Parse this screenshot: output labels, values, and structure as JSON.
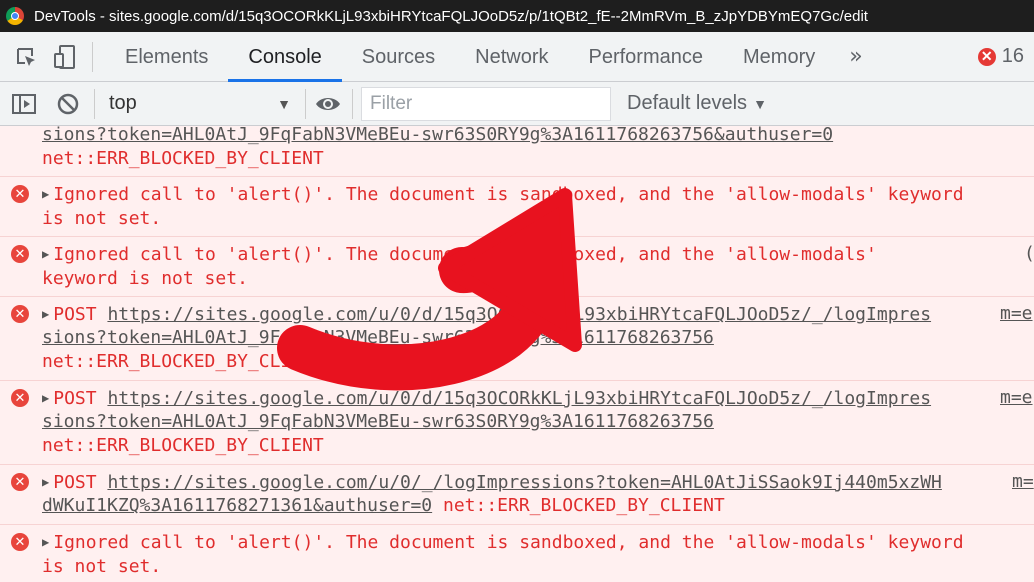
{
  "window": {
    "title": "DevTools - sites.google.com/d/15q3OCORkKLjL93xbiHRYtcaFQLJOoD5z/p/1tQBt2_fE--2MmRVm_B_zJpYDBYmEQ7Gc/edit"
  },
  "tabs": [
    "Elements",
    "Console",
    "Sources",
    "Network",
    "Performance",
    "Memory"
  ],
  "more_tabs": "»",
  "error_count": "16",
  "toolbar": {
    "context": "top",
    "filter_placeholder": "Filter",
    "levels": "Default levels"
  },
  "messages": [
    {
      "line1": "sions?token=AHL0AtJ_9FqFabN3VMeBEu-swr63S0RY9g%3A1611768263756&authuser=0",
      "line2": "net::ERR_BLOCKED_BY_CLIENT"
    },
    {
      "line1": "Ignored call to 'alert()'. The document is sandboxed, and the 'allow-modals' keyword",
      "line2": "is not set."
    },
    {
      "line1": "Ignored call to 'alert()'. The document is sandboxed, and the 'allow-modals'",
      "line1_right": "(",
      "line2": "keyword is not set."
    },
    {
      "method": "POST",
      "url1": "https://sites.google.com/u/0/d/15q3OCORkKLjL93xbiHRYtcaFQLJOoD5z/_/logImpres",
      "url1_right": "m=e",
      "url2": "sions?token=AHL0AtJ_9FqFabN3VMeBEu-swr63S0RY9g%3A1611768263756",
      "line3": "net::ERR_BLOCKED_BY_CLIENT"
    },
    {
      "method": "POST",
      "url1": "https://sites.google.com/u/0/d/15q3OCORkKLjL93xbiHRYtcaFQLJOoD5z/_/logImpres",
      "url1_right": "m=e",
      "url2": "sions?token=AHL0AtJ_9FqFabN3VMeBEu-swr63S0RY9g%3A1611768263756",
      "line3": "net::ERR_BLOCKED_BY_CLIENT"
    },
    {
      "method": "POST",
      "url1": "https://sites.google.com/u/0/_/logImpressions?token=AHL0AtJiSSaok9Ij440m5xzWH",
      "url1_right": "m=",
      "url2": "dWKuI1KZQ%3A1611768271361&authuser=0",
      "line2_tail": "net::ERR_BLOCKED_BY_CLIENT"
    },
    {
      "line1": "Ignored call to 'alert()'. The document is sandboxed, and the 'allow-modals' keyword",
      "line2": "is not set."
    }
  ],
  "icons": {
    "inspect": "inspect-element-icon",
    "device": "device-toolbar-icon",
    "sidebar": "console-sidebar-icon",
    "clear": "clear-console-icon",
    "eye": "live-expression-icon",
    "error": "error-x-icon",
    "arrow": "red-arrow-annotation"
  },
  "colors": {
    "error_text": "#e02d2d",
    "error_bg": "#fff0f0",
    "active_tab": "#1a73e8",
    "arrow": "#e8121f"
  }
}
